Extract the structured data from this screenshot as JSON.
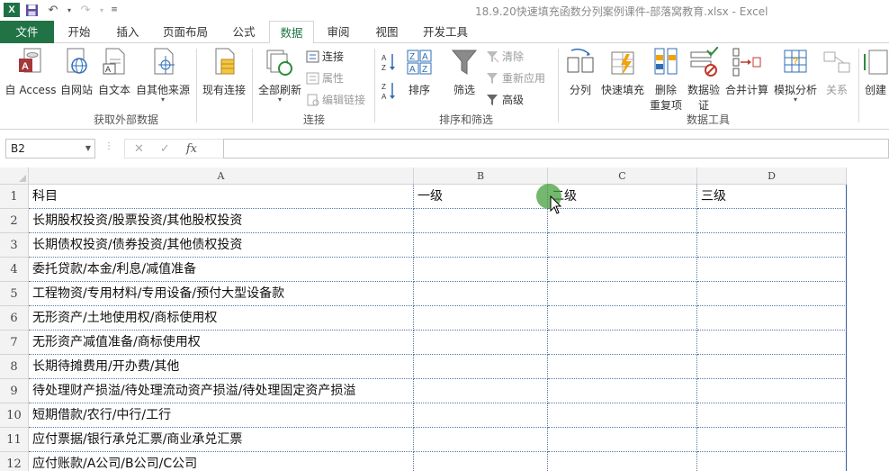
{
  "window": {
    "title": "18.9.20快速填充函数分列案例课件-部落窝教育.xlsx - Excel",
    "app_logo": "X"
  },
  "tabs": [
    "文件",
    "开始",
    "插入",
    "页面布局",
    "公式",
    "数据",
    "审阅",
    "视图",
    "开发工具"
  ],
  "active_tab": "数据",
  "ribbon": {
    "get_external": {
      "access": "自 Access",
      "web": "自网站",
      "text": "自文本",
      "other": "自其他来源",
      "existing": "现有连接",
      "label": "获取外部数据"
    },
    "connections": {
      "refresh_all": "全部刷新",
      "connections": "连接",
      "properties": "属性",
      "edit_links": "编辑链接",
      "label": "连接"
    },
    "sort_filter": {
      "sort": "排序",
      "filter": "筛选",
      "clear": "清除",
      "reapply": "重新应用",
      "advanced": "高级",
      "label": "排序和筛选"
    },
    "data_tools": {
      "split": "分列",
      "flash_fill": "快速填充",
      "remove_dup_1": "删除",
      "remove_dup_2": "重复项",
      "validation_1": "数据验",
      "validation_2": "证",
      "consolidate": "合并计算",
      "what_if": "模拟分析",
      "relationships": "关系",
      "label": "数据工具"
    },
    "outline": {
      "create": "创建"
    }
  },
  "formula_bar": {
    "name_box": "B2",
    "fx": "fx",
    "value": ""
  },
  "sheet": {
    "columns": [
      "A",
      "B",
      "C",
      "D"
    ],
    "rows": [
      [
        "科目",
        "一级",
        "二级",
        "三级"
      ],
      [
        "长期股权投资/股票投资/其他股权投资",
        "",
        "",
        ""
      ],
      [
        "长期债权投资/债券投资/其他债权投资",
        "",
        "",
        ""
      ],
      [
        "委托贷款/本金/利息/减值准备",
        "",
        "",
        ""
      ],
      [
        "工程物资/专用材料/专用设备/预付大型设备款",
        "",
        "",
        ""
      ],
      [
        "无形资产/土地使用权/商标使用权",
        "",
        "",
        ""
      ],
      [
        "无形资产减值准备/商标使用权",
        "",
        "",
        ""
      ],
      [
        "长期待摊费用/开办费/其他",
        "",
        "",
        ""
      ],
      [
        "待处理财产损溢/待处理流动资产损溢/待处理固定资产损溢",
        "",
        "",
        ""
      ],
      [
        "短期借款/农行/中行/工行",
        "",
        "",
        ""
      ],
      [
        "应付票据/银行承兑汇票/商业承兑汇票",
        "",
        "",
        ""
      ],
      [
        "应付账款/A公司/B公司/C公司",
        "",
        "",
        ""
      ]
    ],
    "row_numbers": [
      "1",
      "2",
      "3",
      "4",
      "5",
      "6",
      "7",
      "8",
      "9",
      "10",
      "11",
      "12"
    ]
  }
}
